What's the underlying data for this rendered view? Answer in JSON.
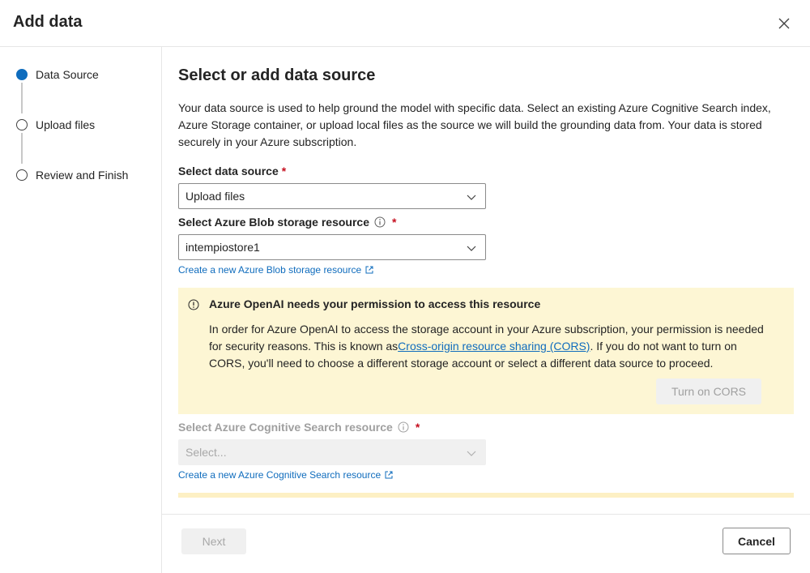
{
  "dialog": {
    "title": "Add data"
  },
  "steps": [
    {
      "label": "Data Source",
      "state": "active"
    },
    {
      "label": "Upload files",
      "state": "pending"
    },
    {
      "label": "Review and Finish",
      "state": "pending"
    }
  ],
  "main": {
    "title": "Select or add data source",
    "description": "Your data source is used to help ground the model with specific data. Select an existing Azure Cognitive Search index, Azure Storage container, or upload local files as the source we will build the grounding data from. Your data is stored securely in your Azure subscription.",
    "data_source": {
      "label": "Select data source",
      "required": "*",
      "value": "Upload files"
    },
    "blob_storage": {
      "label": "Select Azure Blob storage resource",
      "required": "*",
      "value": "intempiostore1",
      "create_link": "Create a new Azure Blob storage resource"
    },
    "warning": {
      "title": "Azure OpenAI needs your permission to access this resource",
      "body_before": "In order for Azure OpenAI to access the storage account in your Azure subscription, your permission is needed for security reasons. This is known as",
      "link": "Cross-origin resource sharing (CORS)",
      "body_after": ". If you do not want to turn on CORS, you'll need to choose a different storage account or select a different data source to proceed.",
      "button": "Turn on CORS"
    },
    "cognitive_search": {
      "label": "Select Azure Cognitive Search resource",
      "required": "*",
      "placeholder": "Select...",
      "create_link": "Create a new Azure Cognitive Search resource"
    }
  },
  "footer": {
    "next": "Next",
    "cancel": "Cancel"
  },
  "colors": {
    "accent": "#0f6cbd",
    "warning_bg": "#fdf6d4",
    "required": "#c50f1f"
  }
}
